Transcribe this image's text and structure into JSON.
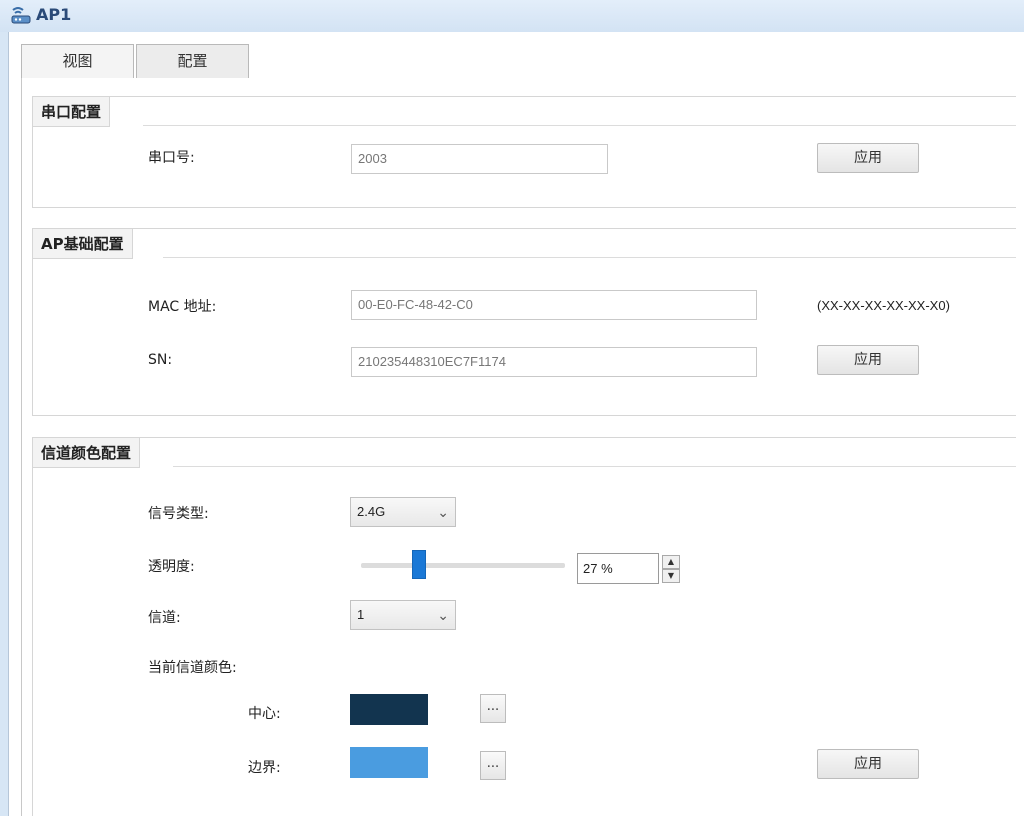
{
  "window": {
    "title": "AP1",
    "icon": "network-device-icon"
  },
  "tabs": [
    {
      "label": "视图",
      "active": false
    },
    {
      "label": "配置",
      "active": true
    }
  ],
  "serial_config": {
    "title": "串口配置",
    "port_label": "串口号:",
    "port_value": "2003",
    "apply_label": "应用"
  },
  "ap_basic": {
    "title": "AP基础配置",
    "mac_label": "MAC 地址:",
    "mac_value": "00-E0-FC-48-42-C0",
    "mac_format_hint": "(XX-XX-XX-XX-XX-X0)",
    "sn_label": "SN:",
    "sn_value": "210235448310EC7F1174",
    "apply_label": "应用"
  },
  "channel_color": {
    "title": "信道颜色配置",
    "signal_type_label": "信号类型:",
    "signal_type_value": "2.4G",
    "transparency_label": "透明度:",
    "transparency_value": "27 %",
    "transparency_percent": 27,
    "channel_label": "信道:",
    "channel_value": "1",
    "current_color_label": "当前信道颜色:",
    "center_label": "中心:",
    "center_color": "#12344f",
    "border_label": "边界:",
    "border_color": "#4a9ce0",
    "picker_label": "...",
    "apply_label": "应用"
  }
}
